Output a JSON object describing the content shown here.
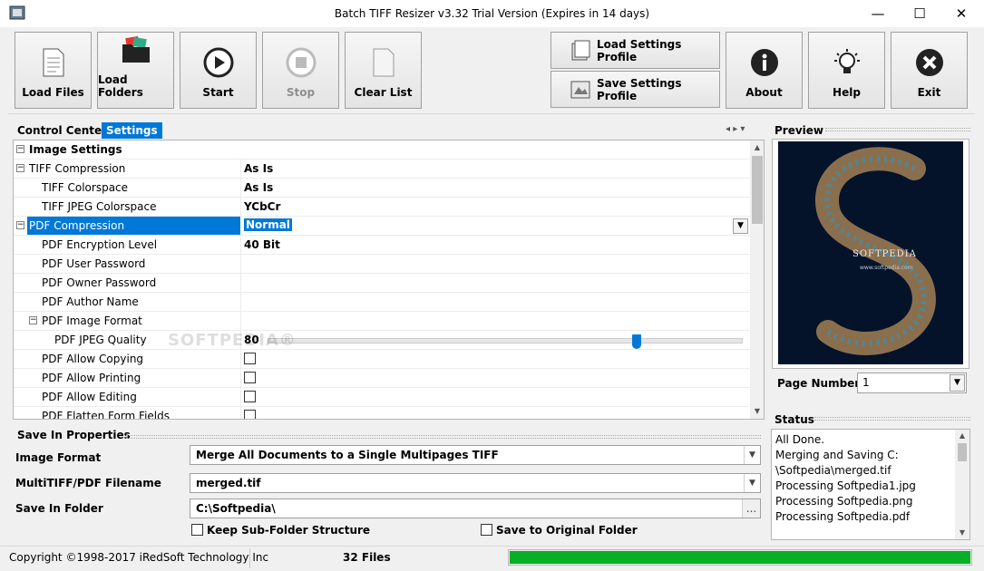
{
  "window": {
    "title": "Batch TIFF Resizer v3.32   Trial Version (Expires in 14 days)",
    "minimize": "—",
    "maximize": "☐",
    "close": "✕"
  },
  "toolbar": {
    "load_files": "Load Files",
    "load_folders": "Load Folders",
    "start": "Start",
    "stop": "Stop",
    "clear_list": "Clear List",
    "load_settings_profile": "Load Settings Profile",
    "save_settings_profile": "Save Settings Profile",
    "about": "About",
    "help": "Help",
    "exit": "Exit"
  },
  "tabs": {
    "control_center": "Control Center",
    "settings": "Settings",
    "nav": "◂ ▸ ▾"
  },
  "grid": {
    "rows": [
      {
        "name": "Image Settings",
        "value": ""
      },
      {
        "name": "TIFF Compression",
        "value": "As Is"
      },
      {
        "name": "TIFF Colorspace",
        "value": "As Is"
      },
      {
        "name": "TIFF JPEG Colorspace",
        "value": "YCbCr"
      },
      {
        "name": "PDF Compression",
        "value": "Normal"
      },
      {
        "name": "PDF Encryption Level",
        "value": "40 Bit"
      },
      {
        "name": "PDF User Password",
        "value": ""
      },
      {
        "name": "PDF Owner Password",
        "value": ""
      },
      {
        "name": "PDF Author Name",
        "value": ""
      },
      {
        "name": "PDF Image Format",
        "value": ""
      },
      {
        "name": "PDF JPEG Quality",
        "value": "80"
      },
      {
        "name": "PDF Allow Copying",
        "value": ""
      },
      {
        "name": "PDF Allow Printing",
        "value": ""
      },
      {
        "name": "PDF Allow Editing",
        "value": ""
      },
      {
        "name": "PDF Flatten Form Fields",
        "value": ""
      }
    ],
    "jpeg_quality_fraction": 0.78,
    "watermark": "SOFTPEDIA®"
  },
  "save": {
    "header": "Save In Properties",
    "image_format_label": "Image Format",
    "image_format_value": "Merge All Documents to a Single Multipages TIFF",
    "filename_label": "MultiTIFF/PDF Filename",
    "filename_value": "merged.tif",
    "folder_label": "Save In Folder",
    "folder_value": "C:\\Softpedia\\",
    "browse": "...",
    "keep_subfolder": "Keep Sub-Folder Structure",
    "save_original": "Save to Original Folder"
  },
  "preview": {
    "header": "Preview",
    "image_text": "SOFTPEDIA",
    "image_subtext": "www.softpedia.com",
    "page_number_label": "Page Number",
    "page_number_value": "1"
  },
  "status": {
    "header": "Status",
    "lines": [
      "All Done.",
      "Merging and Saving C:",
      "\\Softpedia\\merged.tif",
      "Processing Softpedia1.jpg",
      "Processing Softpedia.png",
      "Processing Softpedia.pdf"
    ]
  },
  "statusbar": {
    "copyright": "Copyright ©1998-2017 iRedSoft Technology Inc",
    "file_count": "32 Files",
    "progress": 1.0
  },
  "colors": {
    "selection": "#0078d7",
    "progress": "#06b025",
    "tab_active": "#0078d7"
  }
}
